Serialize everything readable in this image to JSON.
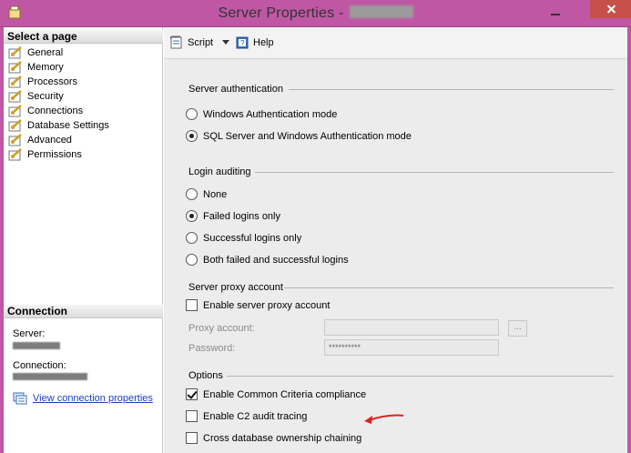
{
  "window": {
    "title": "Server Properties -",
    "colors": {
      "frame": "#bf57a4",
      "close": "#c7504a",
      "link": "#1a3fbf",
      "annotation_arrow": "#e02020"
    }
  },
  "select_page": {
    "header": "Select a page",
    "items": [
      "General",
      "Memory",
      "Processors",
      "Security",
      "Connections",
      "Database Settings",
      "Advanced",
      "Permissions"
    ]
  },
  "connection": {
    "header": "Connection",
    "server_label": "Server:",
    "connection_label": "Connection:",
    "view_link": "View connection properties"
  },
  "toolbar": {
    "script_label": "Script",
    "help_label": "Help"
  },
  "server_authentication": {
    "title": "Server authentication",
    "options": [
      {
        "label": "Windows Authentication mode",
        "selected": false
      },
      {
        "label": "SQL Server and Windows Authentication mode",
        "selected": true
      }
    ]
  },
  "login_auditing": {
    "title": "Login auditing",
    "options": [
      {
        "label": "None",
        "selected": false
      },
      {
        "label": "Failed logins only",
        "selected": true
      },
      {
        "label": "Successful logins only",
        "selected": false
      },
      {
        "label": "Both failed and successful logins",
        "selected": false
      }
    ]
  },
  "proxy": {
    "title": "Server proxy account",
    "enable_label": "Enable server proxy account",
    "enable_checked": false,
    "proxy_account_label": "Proxy account:",
    "proxy_account_value": "",
    "password_label": "Password:",
    "password_value": "**********",
    "browse_label": "..."
  },
  "options": {
    "title": "Options",
    "items": [
      {
        "label": "Enable Common Criteria compliance",
        "checked": true
      },
      {
        "label": "Enable C2 audit tracing",
        "checked": false
      },
      {
        "label": "Cross database ownership chaining",
        "checked": false
      }
    ]
  }
}
